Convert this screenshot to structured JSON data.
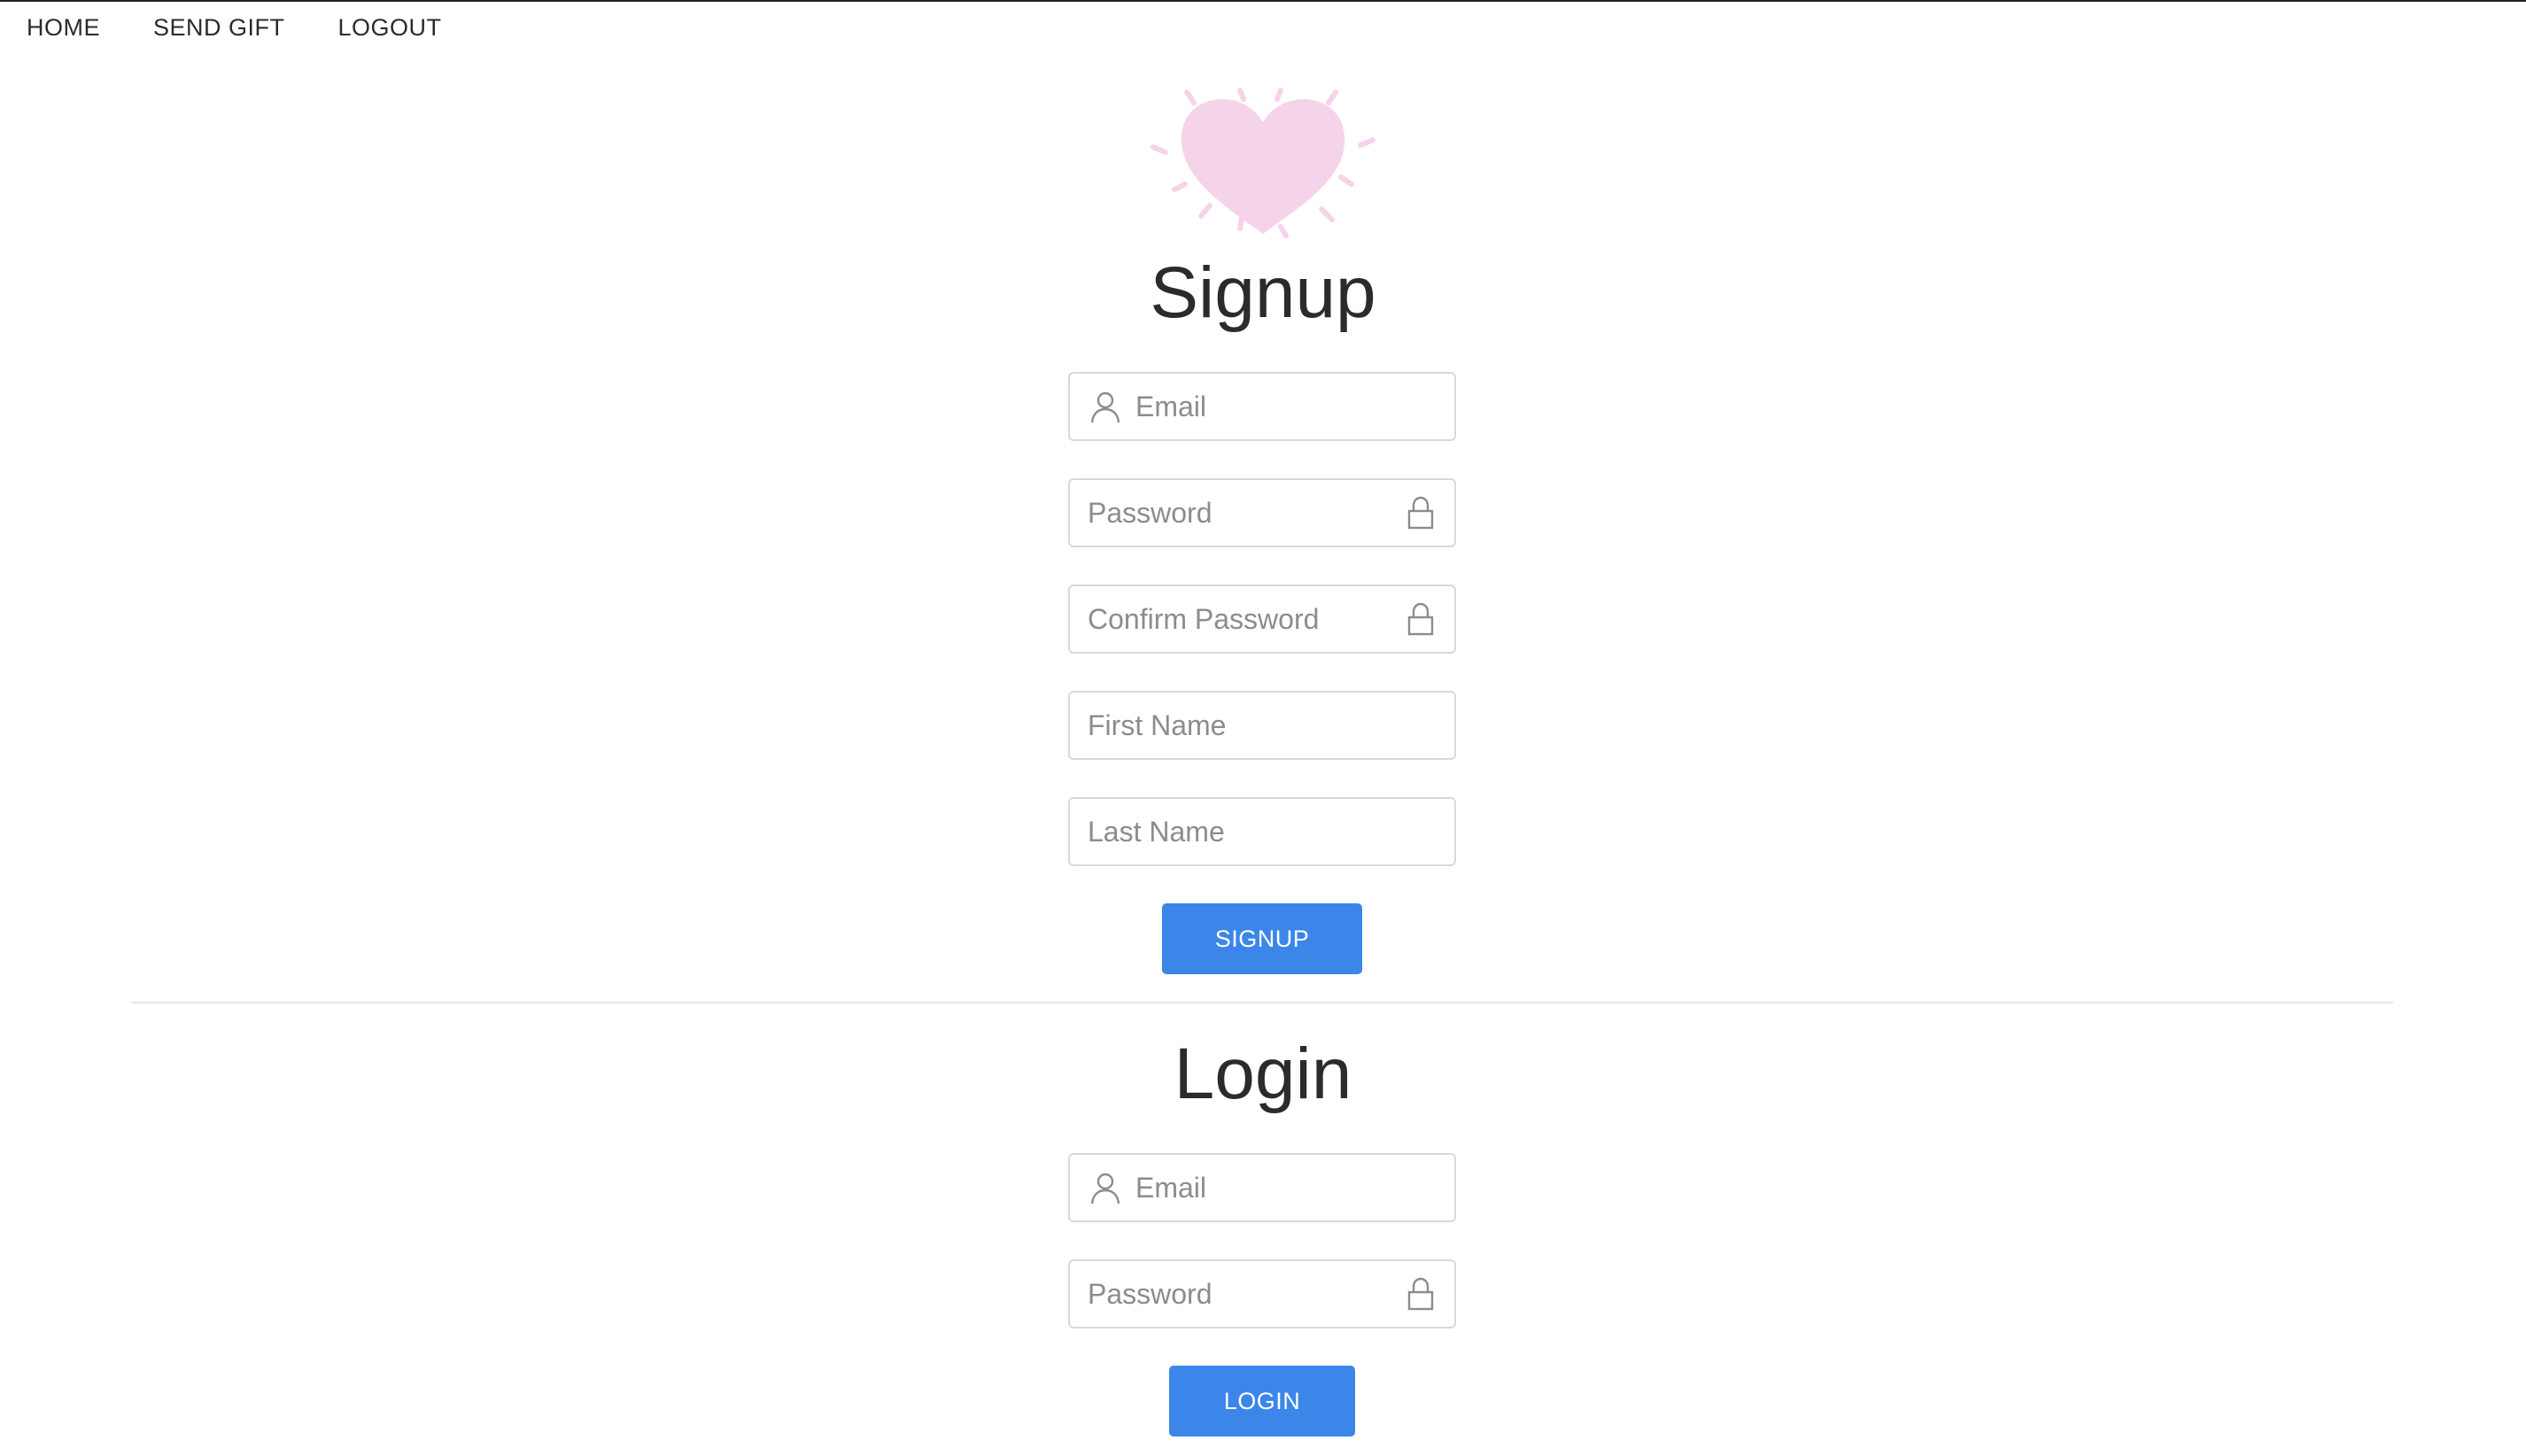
{
  "nav": {
    "items": [
      {
        "label": "HOME"
      },
      {
        "label": "SEND GIFT"
      },
      {
        "label": "LOGOUT"
      }
    ]
  },
  "logo": {
    "icon": "heart-icon",
    "color": "#f5d3e8"
  },
  "signup": {
    "title": "Signup",
    "email_placeholder": "Email",
    "password_placeholder": "Password",
    "confirm_password_placeholder": "Confirm Password",
    "first_name_placeholder": "First Name",
    "last_name_placeholder": "Last Name",
    "button_label": "SIGNUP"
  },
  "login": {
    "title": "Login",
    "email_placeholder": "Email",
    "password_placeholder": "Password",
    "button_label": "LOGIN"
  },
  "colors": {
    "accent": "#3b86e8",
    "text": "#2b2b2b",
    "placeholder": "#8c8c8c",
    "border": "#d9d9d9"
  }
}
